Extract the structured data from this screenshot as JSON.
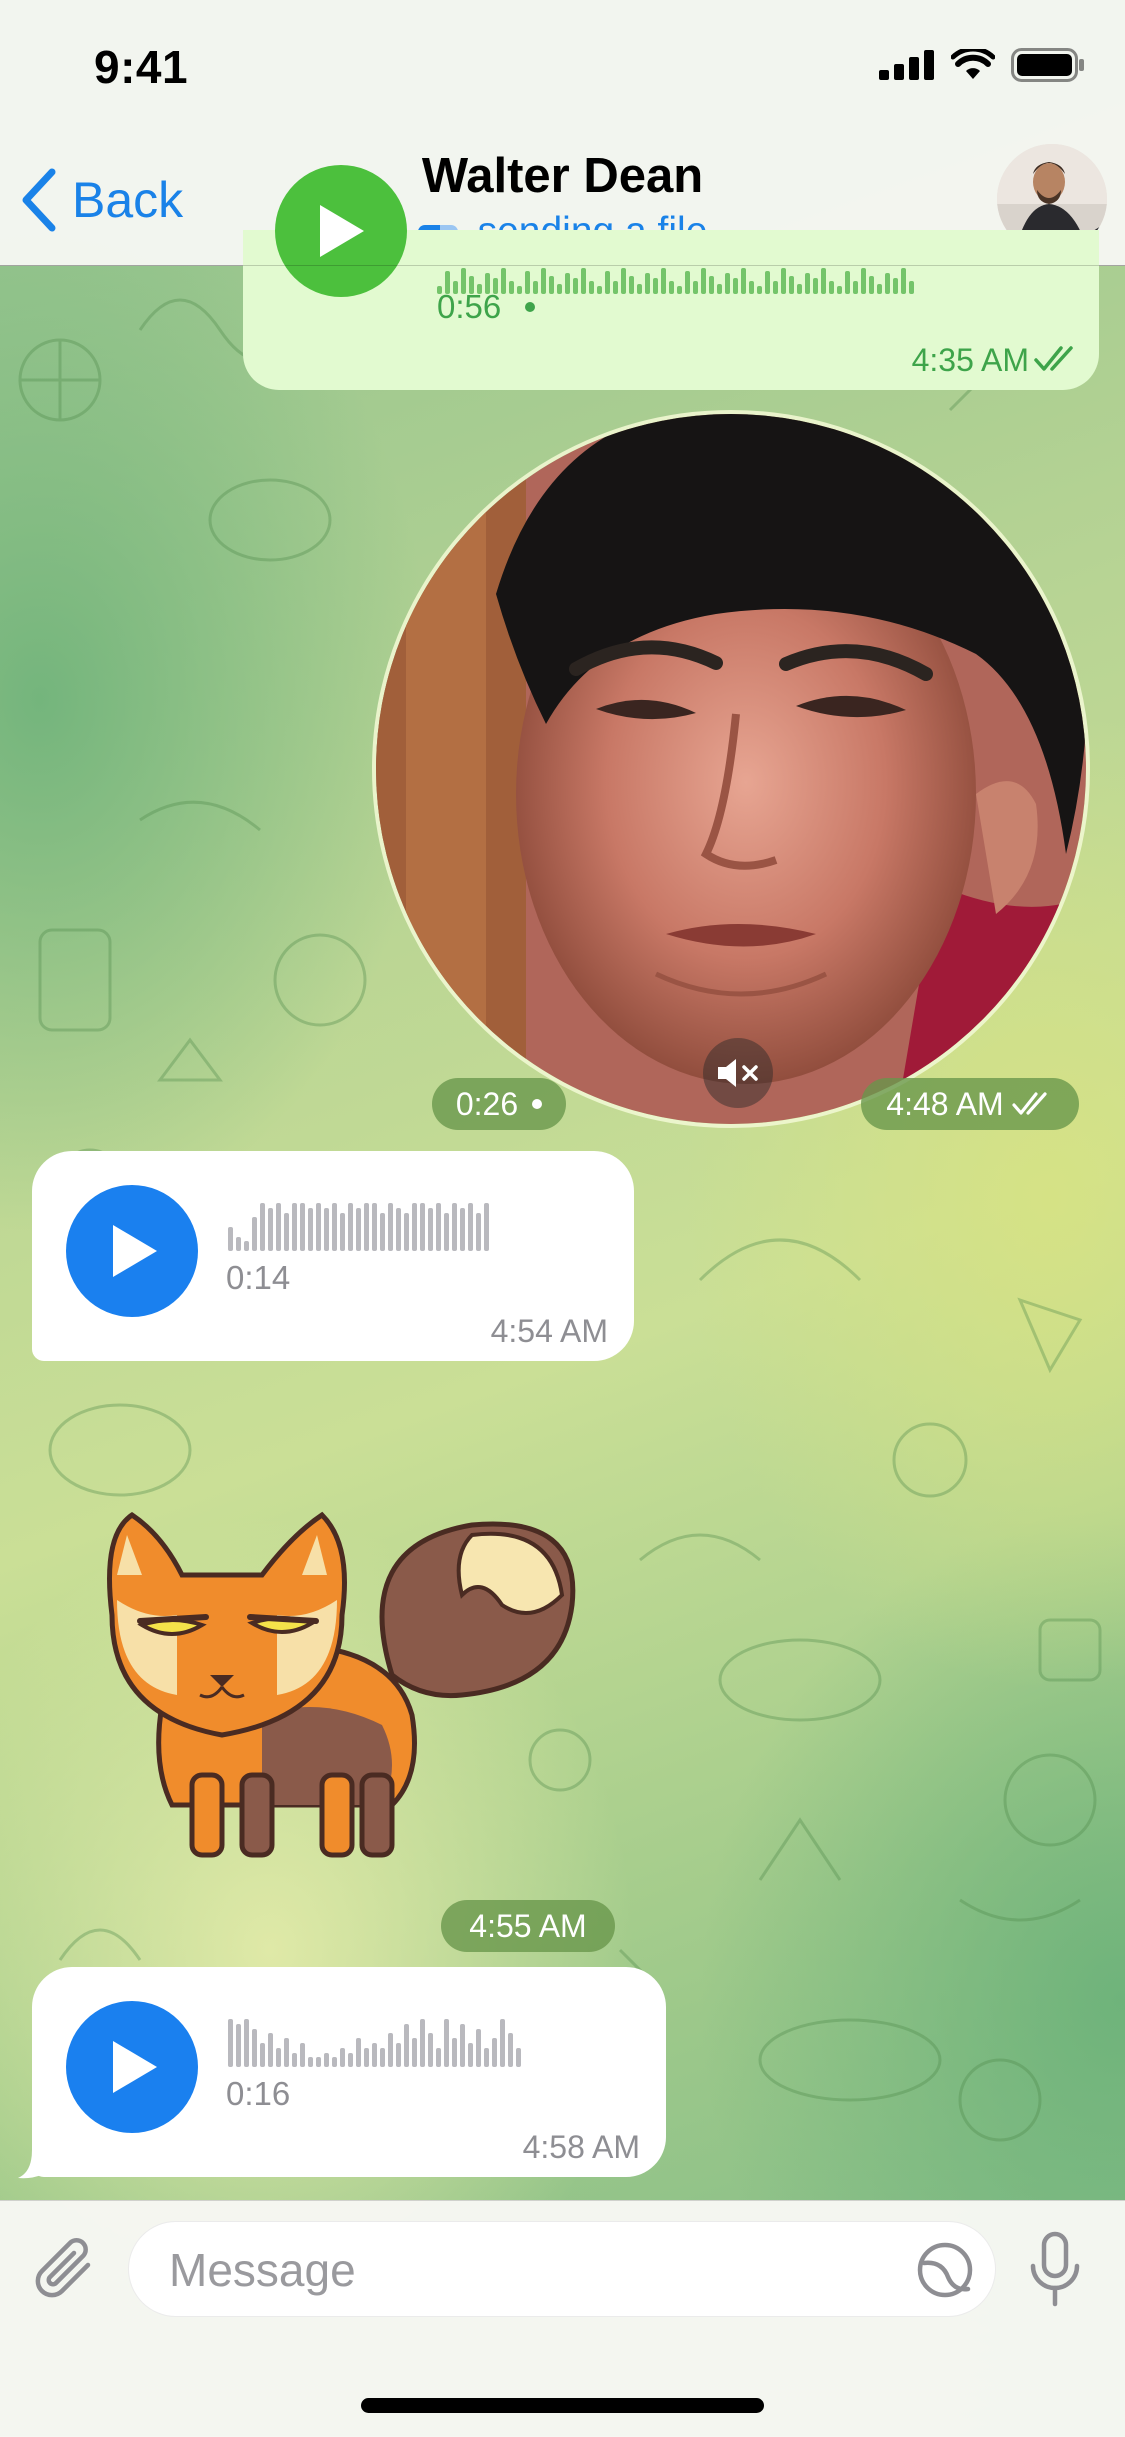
{
  "status_bar": {
    "time": "9:41",
    "icons": [
      "signal-icon",
      "wifi-icon",
      "battery-icon"
    ]
  },
  "header": {
    "back_label": "Back",
    "contact_name": "Walter Dean",
    "status": "sending a file",
    "avatar": "contact-avatar"
  },
  "messages": [
    {
      "type": "voice",
      "direction": "outgoing",
      "duration": "0:56",
      "unplayed": true,
      "time": "4:35 AM",
      "read": true
    },
    {
      "type": "video_message",
      "direction": "outgoing",
      "duration": "0:26",
      "unplayed": true,
      "muted": true,
      "time": "4:48 AM",
      "read": true
    },
    {
      "type": "voice",
      "direction": "incoming",
      "duration": "0:14",
      "time": "4:54 AM"
    },
    {
      "type": "sticker",
      "direction": "incoming",
      "sticker": "fox-sticker",
      "time": "4:55 AM"
    },
    {
      "type": "voice",
      "direction": "incoming",
      "duration": "0:16",
      "time": "4:58 AM"
    }
  ],
  "input_bar": {
    "placeholder": "Message",
    "value": ""
  },
  "colors": {
    "accent": "#1a82e8",
    "outgoing_bubble": "#e2fad0",
    "outgoing_accent": "#4cc03d",
    "incoming_bubble": "#ffffff",
    "incoming_play": "#1a80ef"
  }
}
